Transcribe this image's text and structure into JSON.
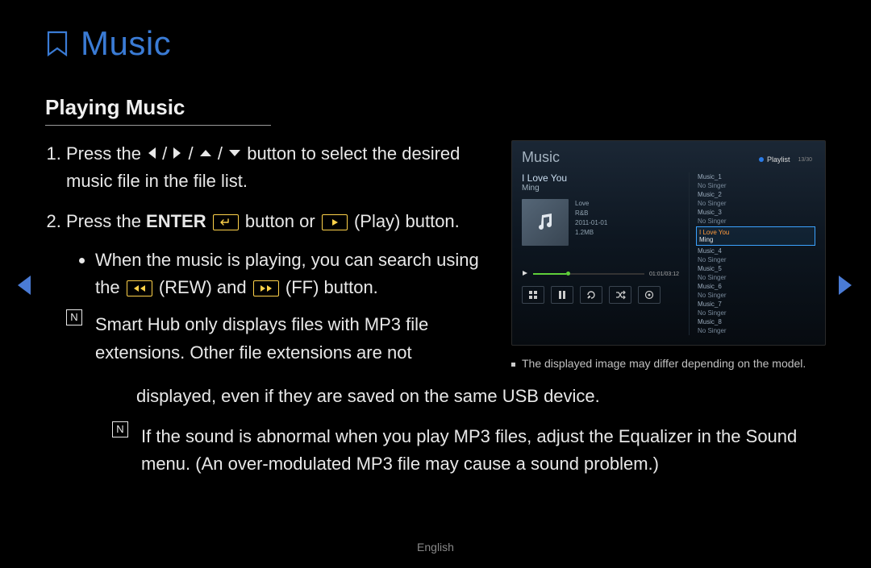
{
  "title": "Music",
  "section": "Playing Music",
  "step1_pre": "Press the ",
  "step1_post": " button to select the desired music file in the file list.",
  "step2_pre": "Press the ",
  "step2_enter": "ENTER",
  "step2_mid": " button or ",
  "step2_play_label": " (Play) button.",
  "bullet1_pre": "When the music is playing, you can search using the ",
  "bullet1_rew": " (REW) and ",
  "bullet1_ff": " (FF) button.",
  "note1": "Smart Hub only displays files with MP3 file extensions. Other file extensions are not displayed, even if they are saved on the same USB device.",
  "note2": "If the sound is abnormal when you play MP3 files, adjust the Equalizer in the Sound menu. (An over-modulated MP3 file may cause a sound problem.)",
  "caption": "The displayed image may differ depending on the model.",
  "footer": "English",
  "preview": {
    "title": "Music",
    "tab": "Playlist",
    "page": "13/30",
    "song": "I Love You",
    "artist": "Ming",
    "genre": "Love",
    "subgenre": "R&B",
    "date": "2011-01-01",
    "size": "1.2MB",
    "time": "01:01/03:12",
    "list": [
      {
        "name": "Music_1",
        "artist": "No Singer"
      },
      {
        "name": "Music_2",
        "artist": "No Singer"
      },
      {
        "name": "Music_3",
        "artist": "No Singer"
      }
    ],
    "selected": {
      "name": "I Love You",
      "artist": "Ming"
    },
    "list2": [
      {
        "name": "Music_4",
        "artist": "No Singer"
      },
      {
        "name": "Music_5",
        "artist": "No Singer"
      },
      {
        "name": "Music_6",
        "artist": "No Singer"
      },
      {
        "name": "Music_7",
        "artist": "No Singer"
      },
      {
        "name": "Music_8",
        "artist": "No Singer"
      }
    ]
  },
  "note_glyph": "N",
  "enter_glyph": "E"
}
